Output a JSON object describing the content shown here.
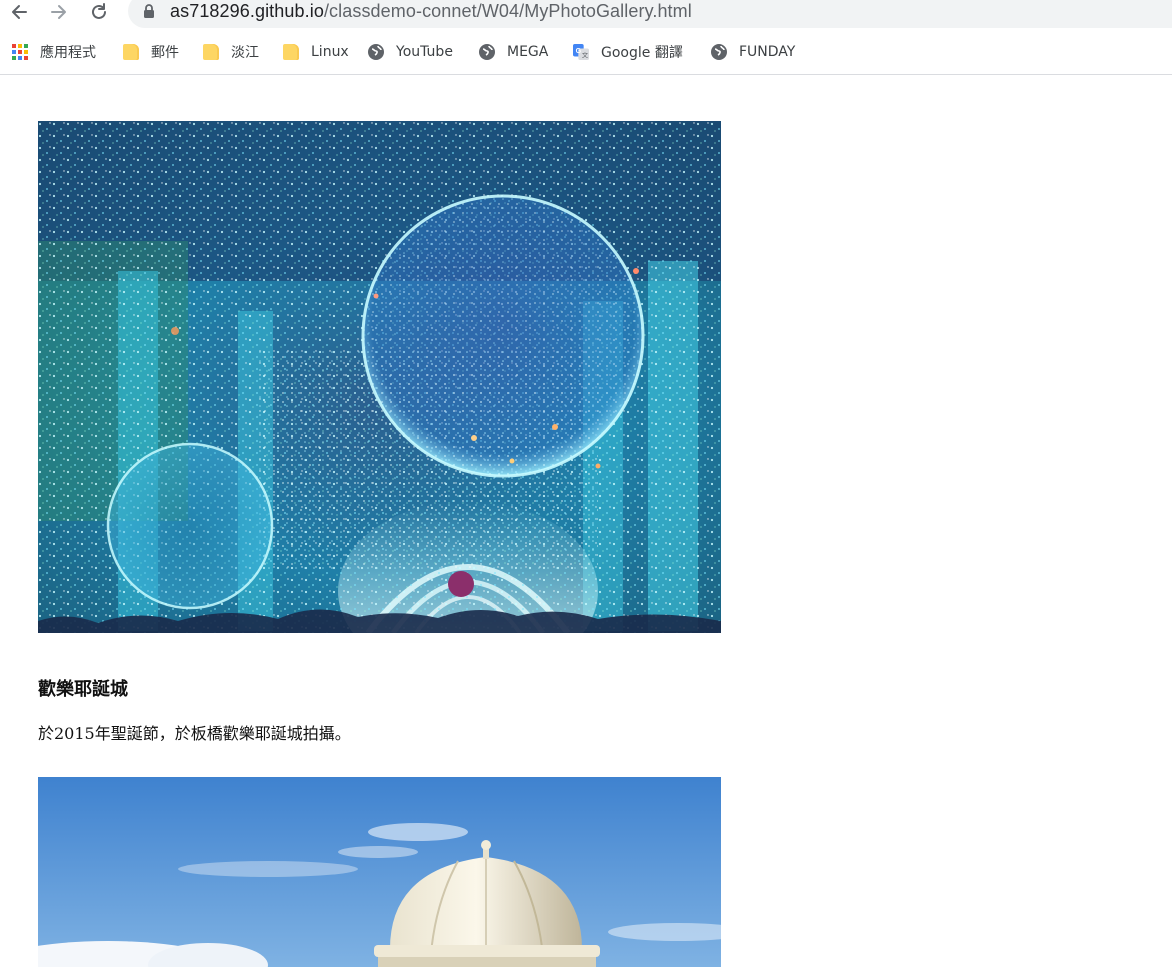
{
  "browser": {
    "url_host": "as718296.github.io",
    "url_path": "/classdemo-connet/W04/MyPhotoGallery.html",
    "back_icon": "arrow-left-icon",
    "forward_icon": "arrow-right-icon",
    "reload_icon": "reload-icon",
    "lock_icon": "lock-icon"
  },
  "bookmarks": [
    {
      "label": "應用程式",
      "icon": "apps-grid-icon"
    },
    {
      "label": "郵件",
      "icon": "folder-icon"
    },
    {
      "label": "淡江",
      "icon": "folder-icon"
    },
    {
      "label": "Linux",
      "icon": "folder-icon"
    },
    {
      "label": "YouTube",
      "icon": "globe-icon"
    },
    {
      "label": "MEGA",
      "icon": "globe-icon"
    },
    {
      "label": "Google 翻譯",
      "icon": "google-translate-icon"
    },
    {
      "label": "FUNDAY",
      "icon": "globe-icon"
    }
  ],
  "gallery": {
    "items": [
      {
        "title": "歡樂耶誕城",
        "description": "於2015年聖誕節，於板橋歡樂耶誕城拍攝。",
        "image": "christmas-light-tunnel-photo"
      },
      {
        "image": "white-dome-sky-photo"
      }
    ]
  }
}
